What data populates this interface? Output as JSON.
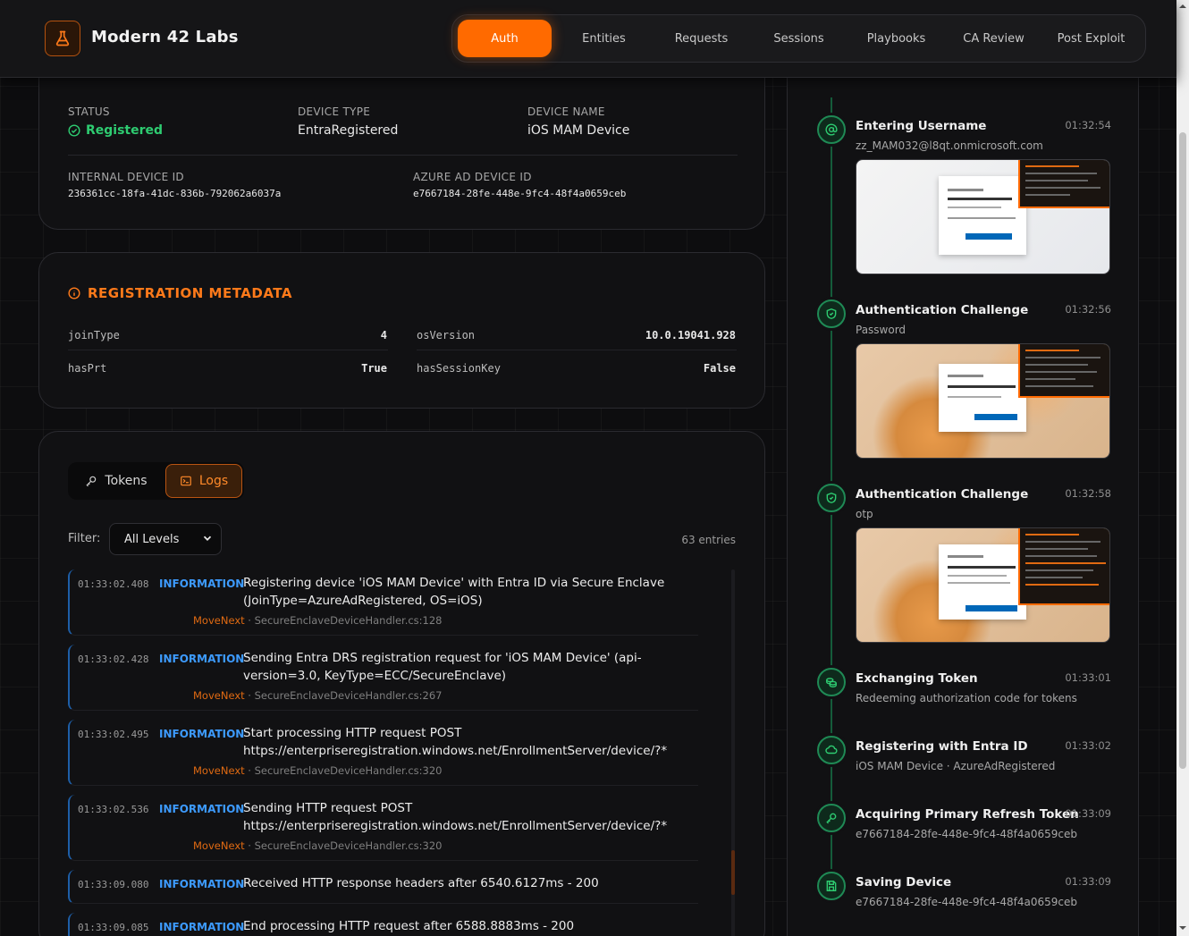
{
  "brand": {
    "name": "Modern 42 Labs",
    "logo_icon": "flask-icon",
    "accent": "#ff6a00"
  },
  "nav": {
    "tabs": [
      {
        "label": "Auth",
        "active": true
      },
      {
        "label": "Entities",
        "active": false
      },
      {
        "label": "Requests",
        "active": false
      },
      {
        "label": "Sessions",
        "active": false
      },
      {
        "label": "Playbooks",
        "active": false
      },
      {
        "label": "CA Review",
        "active": false
      },
      {
        "label": "Post Exploit",
        "active": false
      }
    ]
  },
  "device": {
    "status_label": "STATUS",
    "status_value": "Registered",
    "status_color": "#2ecc71",
    "device_type_label": "DEVICE TYPE",
    "device_type_value": "EntraRegistered",
    "device_name_label": "DEVICE NAME",
    "device_name_value": "iOS MAM Device",
    "internal_id_label": "INTERNAL DEVICE ID",
    "internal_id_value": "236361cc-18fa-41dc-836b-792062a6037a",
    "azure_id_label": "AZURE AD DEVICE ID",
    "azure_id_value": "e7667184-28fe-448e-9fc4-48f4a0659ceb"
  },
  "metadata": {
    "title": "REGISTRATION METADATA",
    "rows": [
      {
        "key": "joinType",
        "value": "4"
      },
      {
        "key": "osVersion",
        "value": "10.0.19041.928"
      },
      {
        "key": "hasPrt",
        "value": "True"
      },
      {
        "key": "hasSessionKey",
        "value": "False"
      }
    ]
  },
  "logs_panel": {
    "tokens_label": "Tokens",
    "logs_label": "Logs",
    "filter_label": "Filter:",
    "filter_value": "All Levels",
    "entries": "63 entries",
    "level_color": "#3d9bff",
    "rows": [
      {
        "time": "01:33:02.408",
        "level": "INFORMATION",
        "message": "Registering device 'iOS MAM Device' with Entra ID via Secure Enclave (JoinType=AzureAdRegistered, OS=iOS)",
        "method": "MoveNext",
        "source": "SecureEnclaveDeviceHandler.cs:128"
      },
      {
        "time": "01:33:02.428",
        "level": "INFORMATION",
        "message": "Sending Entra DRS registration request for 'iOS MAM Device' (api-version=3.0, KeyType=ECC/SecureEnclave)",
        "method": "MoveNext",
        "source": "SecureEnclaveDeviceHandler.cs:267"
      },
      {
        "time": "01:33:02.495",
        "level": "INFORMATION",
        "message": "Start processing HTTP request POST https://enterpriseregistration.windows.net/EnrollmentServer/device/?*",
        "method": "MoveNext",
        "source": "SecureEnclaveDeviceHandler.cs:320"
      },
      {
        "time": "01:33:02.536",
        "level": "INFORMATION",
        "message": "Sending HTTP request POST https://enterpriseregistration.windows.net/EnrollmentServer/device/?*",
        "method": "MoveNext",
        "source": "SecureEnclaveDeviceHandler.cs:320"
      },
      {
        "time": "01:33:09.080",
        "level": "INFORMATION",
        "message": "Received HTTP response headers after 6540.6127ms - 200",
        "method": "",
        "source": ""
      },
      {
        "time": "01:33:09.085",
        "level": "INFORMATION",
        "message": "End processing HTTP request after 6588.8883ms - 200",
        "method": "",
        "source": ""
      }
    ]
  },
  "timeline": {
    "items": [
      {
        "title": "Entering Username",
        "time": "01:32:54",
        "subtitle": "zz_MAM032@l8qt.onmicrosoft.com",
        "icon": "at-icon",
        "screenshot": true
      },
      {
        "title": "Authentication Challenge",
        "time": "01:32:56",
        "subtitle": "Password",
        "icon": "shield-icon",
        "screenshot": true
      },
      {
        "title": "Authentication Challenge",
        "time": "01:32:58",
        "subtitle": "otp",
        "icon": "shield-icon",
        "screenshot": true
      },
      {
        "title": "Exchanging Token",
        "time": "01:33:01",
        "subtitle": "Redeeming authorization code for tokens",
        "icon": "coins-icon",
        "screenshot": false
      },
      {
        "title": "Registering with Entra ID",
        "time": "01:33:02",
        "subtitle": "iOS MAM Device · AzureAdRegistered",
        "icon": "cloud-icon",
        "screenshot": false
      },
      {
        "title": "Acquiring Primary Refresh Token",
        "time": "01:33:09",
        "subtitle": "e7667184-28fe-448e-9fc4-48f4a0659ceb",
        "icon": "key-icon",
        "screenshot": false
      },
      {
        "title": "Saving Device",
        "time": "01:33:09",
        "subtitle": "e7667184-28fe-448e-9fc4-48f4a0659ceb",
        "icon": "save-icon",
        "screenshot": false
      }
    ]
  }
}
